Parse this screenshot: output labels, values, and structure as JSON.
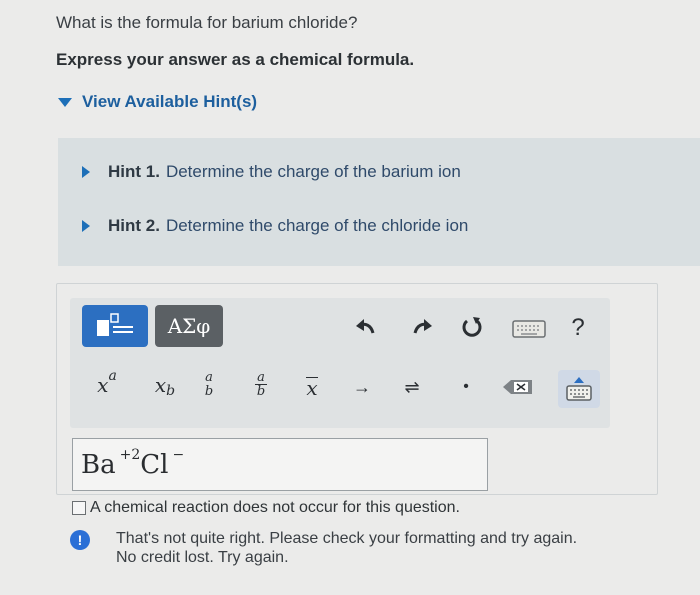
{
  "question": "What is the formula for barium chloride?",
  "instruction": "Express your answer as a chemical formula.",
  "hints_toggle": "View Available Hint(s)",
  "hints": [
    {
      "number": "Hint 1.",
      "text": "Determine the charge of the barium ion"
    },
    {
      "number": "Hint 2.",
      "text": "Determine the charge of the chloride ion"
    }
  ],
  "toolbar": {
    "greek_label": "ΑΣφ",
    "help_label": "?",
    "tools": {
      "superscript_base": "x",
      "superscript_exp": "a",
      "subscript_base": "x",
      "subscript_sub": "b",
      "fraction_num": "a",
      "fraction_den": "b",
      "bar_x": "x",
      "arrow": "→",
      "equilibrium": "⇌",
      "dot": "•"
    }
  },
  "answer": {
    "element1": "Ba",
    "charge1": "+2",
    "element2": "Cl",
    "charge2": "−"
  },
  "no_reaction_label": "A chemical reaction does not occur for this question.",
  "feedback": {
    "line1": "That's not quite right. Please check your formatting and try again.",
    "line2": "No credit lost. Try again."
  },
  "colors": {
    "accent": "#2c6fc1",
    "hint_bg": "#d9dfe1",
    "link": "#1d5f9e"
  }
}
